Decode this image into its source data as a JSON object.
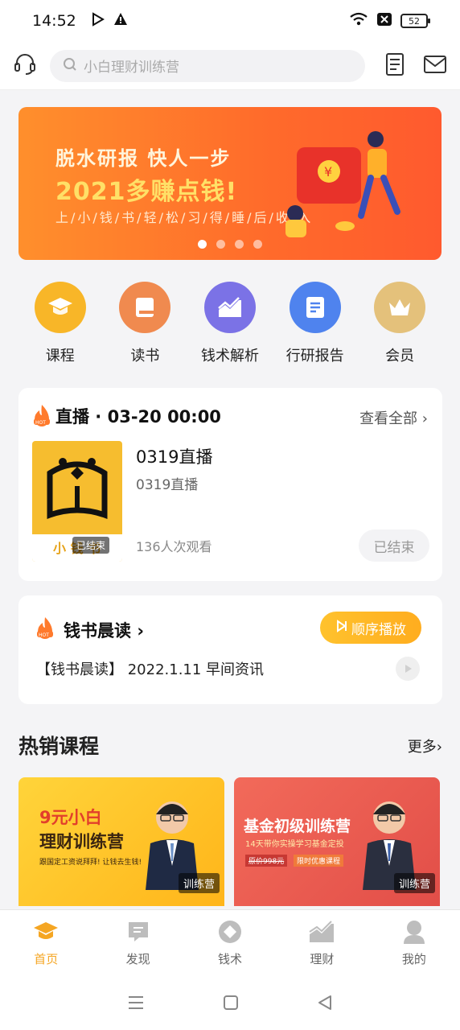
{
  "status": {
    "time": "14:52",
    "battery": "52"
  },
  "header": {
    "search_placeholder": "小白理财训练营"
  },
  "banner": {
    "line1": "脱水研报  快人一步",
    "line2": "2021多赚点钱!",
    "line3": "上/小/钱/书/轻/松/习/得/睡/后/收/入",
    "active_dot": 0
  },
  "categories": [
    {
      "label": "课程",
      "color": "#f8b628"
    },
    {
      "label": "读书",
      "color": "#f08a4f"
    },
    {
      "label": "钱术解析",
      "color": "#7b72e6"
    },
    {
      "label": "行研报告",
      "color": "#4f83ee"
    },
    {
      "label": "会员",
      "color": "#e4c17b"
    }
  ],
  "live": {
    "title": "直播 · 03-20 00:00",
    "see_all": "查看全部",
    "name": "0319直播",
    "subtitle": "0319直播",
    "views": "136人次观看",
    "ended_button": "已结束",
    "thumb_text": "小 钱 书",
    "thumb_badge": "已结束"
  },
  "morning": {
    "title": "钱书晨读",
    "play_button": "顺序播放",
    "item": "【钱书晨读】 2022.1.11 早间资讯"
  },
  "hot": {
    "title": "热销课程",
    "more": "更多",
    "courses": [
      {
        "title_line1": "9元小白",
        "title_line2": "理财训练营",
        "desc": "跟国定工资说拜拜! 让钱去生钱!",
        "tag": "训练营"
      },
      {
        "title_line1": "基金初级训练营",
        "title_line2": "14天带你实操学习基金定投",
        "price_note": "原价998元",
        "promo": "限时优惠课程",
        "tag": "训练营"
      }
    ]
  },
  "nav": [
    {
      "label": "首页",
      "active": true
    },
    {
      "label": "发现",
      "active": false
    },
    {
      "label": "钱术",
      "active": false
    },
    {
      "label": "理财",
      "active": false
    },
    {
      "label": "我的",
      "active": false
    }
  ],
  "colors": {
    "accent": "#f5a623",
    "banner": "#ff7a2c"
  }
}
